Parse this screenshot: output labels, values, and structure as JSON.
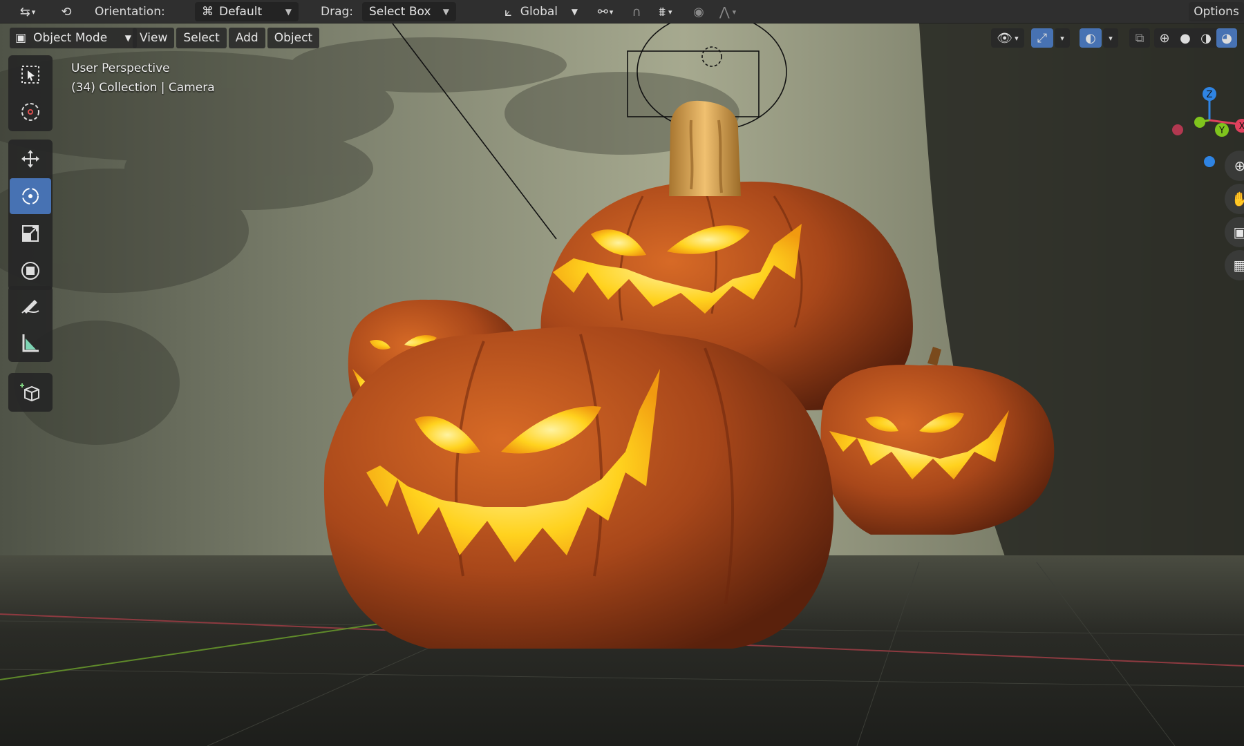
{
  "topbar": {
    "orientation_label": "Orientation:",
    "orientation_value": "Default",
    "drag_label": "Drag:",
    "drag_value": "Select Box",
    "transform_orientation": "Global",
    "options_label": "Options"
  },
  "header": {
    "mode": "Object Mode",
    "menus": [
      "View",
      "Select",
      "Add",
      "Object"
    ]
  },
  "viewport": {
    "view_name": "User Perspective",
    "collection_info": "(34) Collection | Camera"
  },
  "gizmo": {
    "z": "Z",
    "y": "Y",
    "x": "X"
  },
  "colors": {
    "accent": "#4772b3",
    "pumpkin": "#b8551c",
    "glow": "#ffd21e",
    "wall": "#8e917a",
    "axis_x": "#e0415e",
    "axis_y": "#7fc41d",
    "axis_z": "#2f84e3"
  },
  "toolbar_icons": [
    "select-box-icon",
    "cursor-icon",
    "move-icon",
    "rotate-icon",
    "scale-icon",
    "transform-icon",
    "annotate-icon",
    "measure-icon",
    "add-cube-icon"
  ]
}
